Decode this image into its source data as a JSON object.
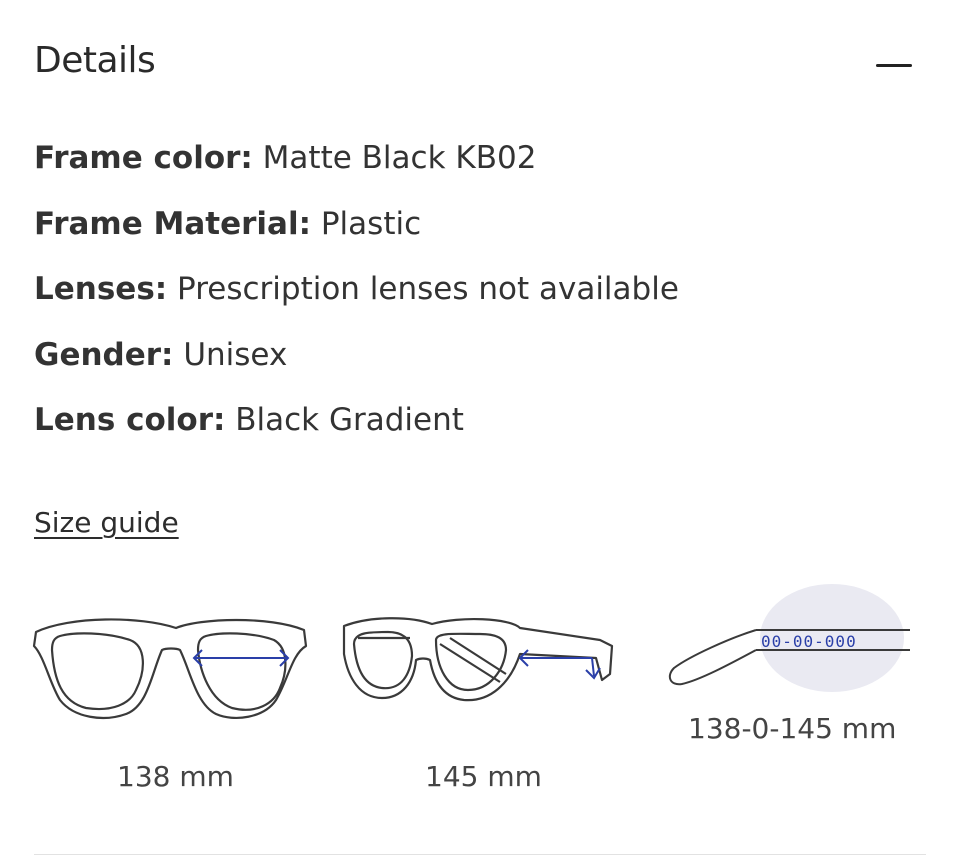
{
  "section": {
    "title": "Details"
  },
  "details": [
    {
      "key": "Frame color:",
      "value": "Matte Black KB02"
    },
    {
      "key": "Frame Material:",
      "value": "Plastic"
    },
    {
      "key": "Lenses:",
      "value": "Prescription lenses not available"
    },
    {
      "key": "Gender:",
      "value": "Unisex"
    },
    {
      "key": "Lens color:",
      "value": "Black Gradient"
    }
  ],
  "size_guide": {
    "link": "Size guide",
    "figures": [
      {
        "name": "frame-width",
        "caption": "138 mm",
        "icon": "glasses-front-icon"
      },
      {
        "name": "temple-length",
        "caption": "145 mm",
        "icon": "glasses-side-icon"
      },
      {
        "name": "temple-marking",
        "caption": "138-0-145 mm",
        "icon": "temple-arm-icon",
        "marking": "00-00-000"
      }
    ]
  },
  "colors": {
    "arrow": "#2a3fa8",
    "highlight": "#eaeaf2",
    "text": "#2b2b2b"
  }
}
